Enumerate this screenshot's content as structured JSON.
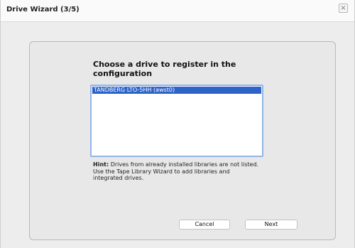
{
  "window": {
    "title": "Drive Wizard (3/5)",
    "close_glyph": "×"
  },
  "prompt": {
    "text": "Choose a drive to register in the configuration"
  },
  "drive_list": {
    "items": [
      {
        "label": "TANDBERG LTO-5HH (awst0)",
        "selected": true
      }
    ]
  },
  "hint": {
    "label": "Hint:",
    "text": "Drives from already installed libraries are not listed. Use the Tape Library Wizard to add libraries and integrated drives."
  },
  "buttons": {
    "cancel": "Cancel",
    "next": "Next"
  },
  "colors": {
    "selection": "#2d63c8",
    "list_focus_border": "#8fb5e8"
  }
}
